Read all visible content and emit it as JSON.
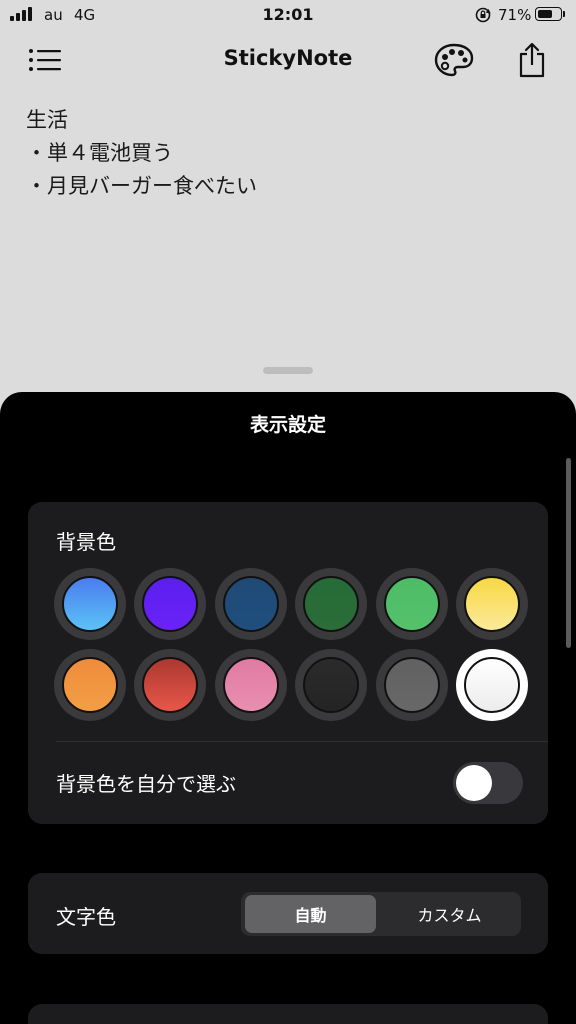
{
  "status_bar": {
    "carrier": "au",
    "network": "4G",
    "time": "12:01",
    "battery_percent": "71%",
    "battery_level": 0.71
  },
  "nav": {
    "title": "StickyNote",
    "menu_icon": "list-icon",
    "palette_icon": "palette-icon",
    "share_icon": "share-icon"
  },
  "note": {
    "lines": [
      "生活",
      "・単４電池買う",
      "・月見バーガー食べたい"
    ]
  },
  "sheet": {
    "title": "表示設定",
    "background_section": {
      "label": "背景色",
      "swatches": [
        {
          "name": "blue",
          "gradient": [
            "#4a7cf0",
            "#5bc3f5"
          ],
          "selected": false
        },
        {
          "name": "purple",
          "gradient": [
            "#5a1ff0",
            "#6b22f5"
          ],
          "selected": false
        },
        {
          "name": "navy",
          "gradient": [
            "#1f4a75",
            "#1f4f7e"
          ],
          "selected": false
        },
        {
          "name": "dark-green",
          "gradient": [
            "#256b38",
            "#2c6d39"
          ],
          "selected": false
        },
        {
          "name": "green",
          "gradient": [
            "#4dbc66",
            "#55c26b"
          ],
          "selected": false
        },
        {
          "name": "yellow",
          "gradient": [
            "#f8d844",
            "#fbea9a"
          ],
          "selected": false
        },
        {
          "name": "orange",
          "gradient": [
            "#f08c3c",
            "#f29e45"
          ],
          "selected": false
        },
        {
          "name": "red",
          "gradient": [
            "#ac3830",
            "#e8574a"
          ],
          "selected": false
        },
        {
          "name": "pink",
          "gradient": [
            "#e07aa2",
            "#e98fb0"
          ],
          "selected": false
        },
        {
          "name": "black",
          "gradient": [
            "#2b2b2b",
            "#242424"
          ],
          "selected": false
        },
        {
          "name": "gray",
          "gradient": [
            "#616161",
            "#686868"
          ],
          "selected": false
        },
        {
          "name": "white",
          "gradient": [
            "#ffffff",
            "#ececec"
          ],
          "selected": true
        }
      ],
      "custom_toggle_label": "背景色を自分で選ぶ",
      "custom_toggle_on": false
    },
    "text_color_section": {
      "label": "文字色",
      "options": [
        "自動",
        "カスタム"
      ],
      "selected": "自動"
    }
  },
  "colors": {
    "light_background": "#dcdcdc",
    "sheet_background": "#000000",
    "card_background": "#1c1c1e",
    "segment_selected": "#636366"
  }
}
